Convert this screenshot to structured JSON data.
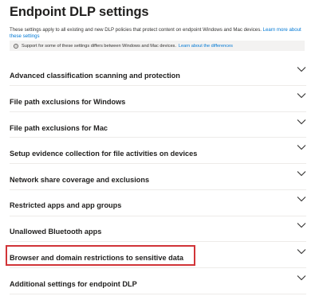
{
  "header": {
    "title": "Endpoint DLP settings",
    "description": "These settings apply to all existing and new DLP policies that protect content on endpoint Windows and Mac devices.",
    "learn_more_link": "Learn more about these settings"
  },
  "notice": {
    "icon": "info-icon",
    "text": "Support for some of these settings differs between Windows and Mac devices.",
    "link": "Learn about the differences"
  },
  "sections": [
    {
      "label": "Advanced classification scanning and protection",
      "highlighted": false
    },
    {
      "label": "File path exclusions for Windows",
      "highlighted": false
    },
    {
      "label": "File path exclusions for Mac",
      "highlighted": false
    },
    {
      "label": "Setup evidence collection for file activities on devices",
      "highlighted": false
    },
    {
      "label": "Network share coverage and exclusions",
      "highlighted": false
    },
    {
      "label": "Restricted apps and app groups",
      "highlighted": false
    },
    {
      "label": "Unallowed Bluetooth apps",
      "highlighted": false
    },
    {
      "label": "Browser and domain restrictions to sensitive data",
      "highlighted": true
    },
    {
      "label": "Additional settings for endpoint DLP",
      "highlighted": false
    }
  ],
  "colors": {
    "link": "#0078d4",
    "highlight_border": "#d13438",
    "notice_background": "#f3f2f1"
  }
}
